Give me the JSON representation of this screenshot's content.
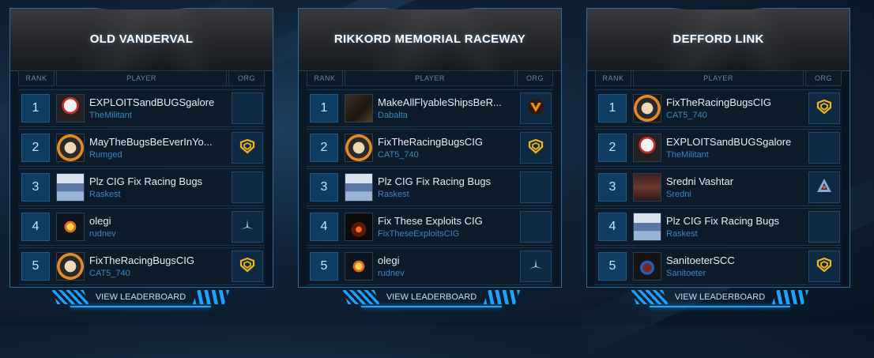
{
  "columns": {
    "rank": "RANK",
    "player": "PLAYER",
    "org": "ORG"
  },
  "view_label": "VIEW LEADERBOARD",
  "accent": "#1ca3ff",
  "panels": [
    {
      "title": "OLD VANDERVAL",
      "rows": [
        {
          "rank": "1",
          "name": "EXPLOITSandBUGSgalore",
          "handle": "TheMilitant",
          "avatar": "gundam-avatar",
          "org": "none"
        },
        {
          "rank": "2",
          "name": "MayTheBugsBeEverInYo...",
          "handle": "Rumged",
          "avatar": "orange-portrait-avatar",
          "org": "gold-shield-icon"
        },
        {
          "rank": "3",
          "name": "Plz CIG Fix Racing Bugs",
          "handle": "Raskest",
          "avatar": "viking-avatar",
          "org": "none"
        },
        {
          "rank": "4",
          "name": "olegi",
          "handle": "rudnev",
          "avatar": "star-avatar",
          "org": "silver-star-icon"
        },
        {
          "rank": "5",
          "name": "FixTheRacingBugsCIG",
          "handle": "CAT5_740",
          "avatar": "orange-portrait-avatar",
          "org": "gold-shield-icon"
        }
      ]
    },
    {
      "title": "RIKKORD MEMORIAL RACEWAY",
      "rows": [
        {
          "rank": "1",
          "name": "MakeAllFlyableShipsBeR...",
          "handle": "Dabalta",
          "avatar": "dark-avatar",
          "org": "orange-v-icon"
        },
        {
          "rank": "2",
          "name": "FixTheRacingBugsCIG",
          "handle": "CAT5_740",
          "avatar": "orange-portrait-avatar",
          "org": "gold-shield-icon"
        },
        {
          "rank": "3",
          "name": "Plz CIG Fix Racing Bugs",
          "handle": "Raskest",
          "avatar": "viking-avatar",
          "org": "none"
        },
        {
          "rank": "4",
          "name": "Fix These Exploits CIG",
          "handle": "FixTheseExploitsCIG",
          "avatar": "fire-avatar",
          "org": "none"
        },
        {
          "rank": "5",
          "name": "olegi",
          "handle": "rudnev",
          "avatar": "star-avatar",
          "org": "silver-star-icon"
        }
      ]
    },
    {
      "title": "DEFFORD LINK",
      "rows": [
        {
          "rank": "1",
          "name": "FixTheRacingBugsCIG",
          "handle": "CAT5_740",
          "avatar": "orange-portrait-avatar",
          "org": "gold-shield-icon"
        },
        {
          "rank": "2",
          "name": "EXPLOITSandBUGSgalore",
          "handle": "TheMilitant",
          "avatar": "gundam-avatar",
          "org": "none"
        },
        {
          "rank": "3",
          "name": "Sredni Vashtar",
          "handle": "Sredni",
          "avatar": "red-avatar",
          "org": "blue-triangle-icon"
        },
        {
          "rank": "4",
          "name": "Plz CIG Fix Racing Bugs",
          "handle": "Raskest",
          "avatar": "viking-avatar",
          "org": "none"
        },
        {
          "rank": "5",
          "name": "SanitoeterSCC",
          "handle": "Sanitoeter",
          "avatar": "helmet-avatar",
          "org": "gold-shield-icon"
        }
      ]
    }
  ]
}
